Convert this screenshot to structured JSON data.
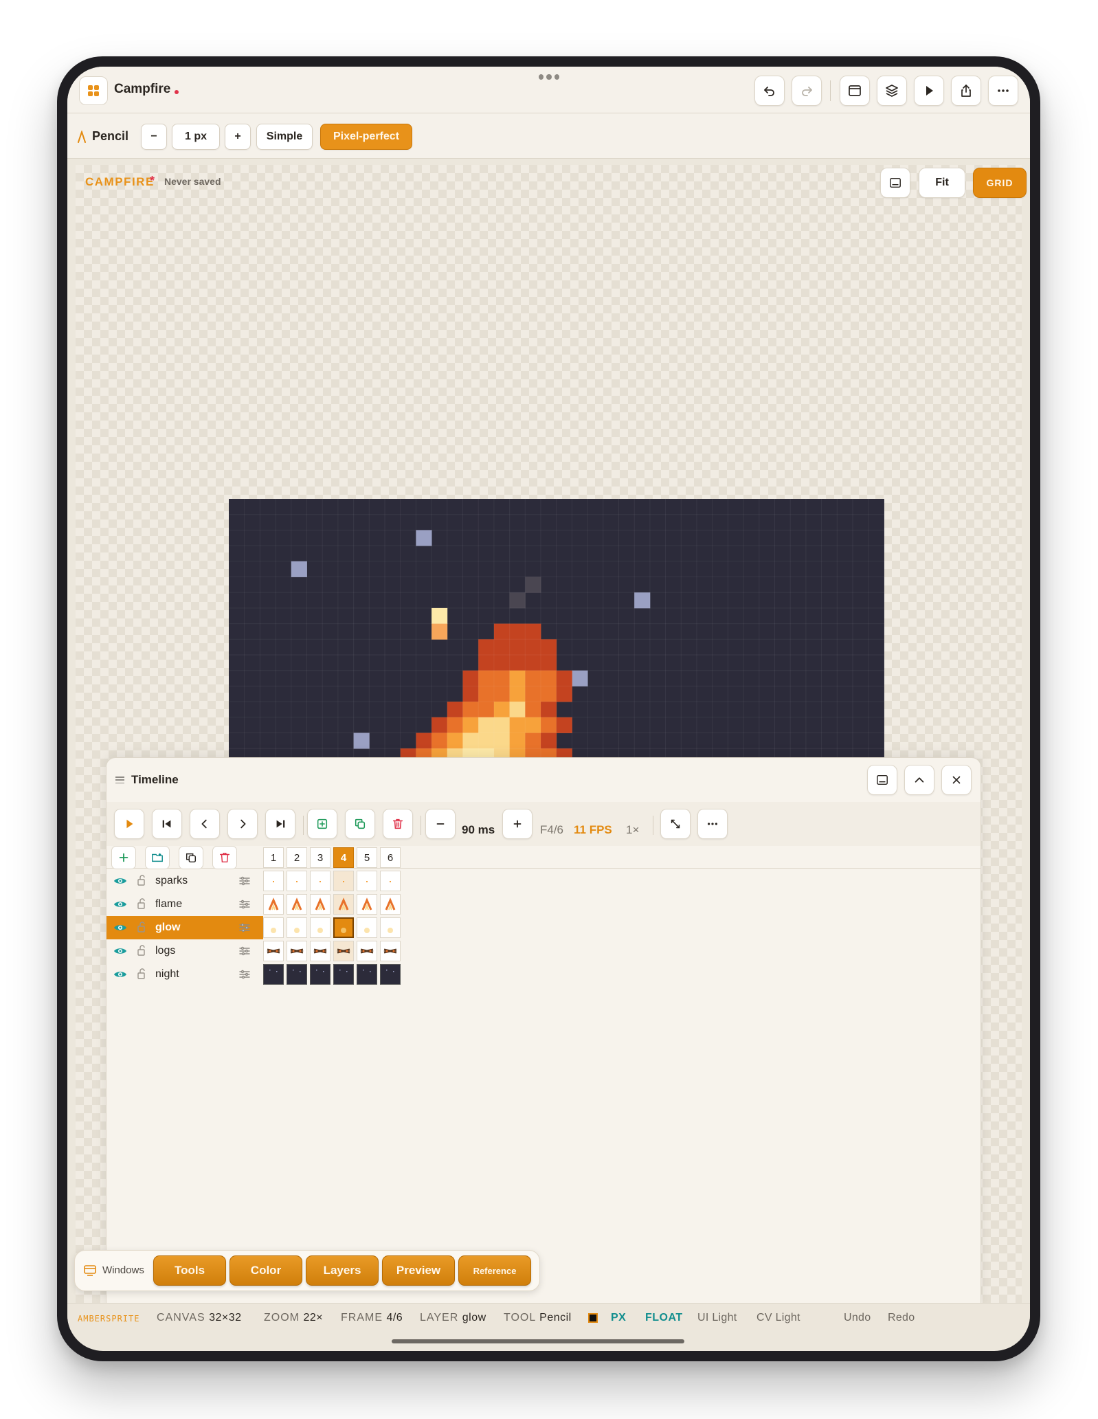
{
  "app": {
    "title": "Campfire",
    "accent": "#e8921a",
    "icons": [
      "undo-icon",
      "redo-icon",
      "window-icon",
      "layers-icon",
      "play-icon",
      "share-icon",
      "more-icon"
    ]
  },
  "tool_options": {
    "tool_name": "Pencil",
    "size_value": "1 px",
    "minus_label": "−",
    "plus_label": "+",
    "mode_simple": "Simple",
    "mode_pixel_perfect": "Pixel-perfect",
    "active_mode": "Pixel-perfect"
  },
  "canvas": {
    "doc_name": "CAMPFIRE",
    "unsaved_mark": "*",
    "save_status": "Never saved",
    "fit_label": "Fit",
    "grid_label": "GRID",
    "sprite_colors": {
      "night": "#2c2b3a",
      "star": "#9aa0c3",
      "smoke": "#4a4651",
      "dark_red": "#c44320",
      "orange": "#e8722a",
      "amber": "#f7a23b",
      "yellow": "#fbd88a",
      "pale": "#fde9a8",
      "light_orange": "#f7a65a"
    }
  },
  "timeline": {
    "title": "Timeline",
    "duration": "90 ms",
    "frame_indicator": "F4/6",
    "fps": "11 FPS",
    "speed": "1×",
    "frames": [
      "1",
      "2",
      "3",
      "4",
      "5",
      "6"
    ],
    "current_frame": 4,
    "layers": [
      {
        "name": "sparks",
        "visible": true,
        "locked": false,
        "active": false
      },
      {
        "name": "flame",
        "visible": true,
        "locked": false,
        "active": false
      },
      {
        "name": "glow",
        "visible": true,
        "locked": false,
        "active": true
      },
      {
        "name": "logs",
        "visible": true,
        "locked": false,
        "active": false
      },
      {
        "name": "night",
        "visible": true,
        "locked": false,
        "active": false
      }
    ]
  },
  "dock": {
    "label": "Windows",
    "buttons": [
      "Tools",
      "Color",
      "Layers",
      "Preview",
      "Reference"
    ]
  },
  "status": {
    "brand": "AMBERSPRITE",
    "canvas_label": "CANVAS",
    "canvas_value": "32×32",
    "zoom_label": "ZOOM",
    "zoom_value": "22×",
    "frame_label": "FRAME",
    "frame_value": "4/6",
    "layer_label": "LAYER",
    "layer_value": "glow",
    "tool_label": "TOOL",
    "tool_value": "Pencil",
    "swatch_color": "#111111",
    "px": "PX",
    "float": "FLOAT",
    "ui_theme": "UI Light",
    "cv_theme": "CV Light",
    "undo": "Undo",
    "redo": "Redo"
  }
}
